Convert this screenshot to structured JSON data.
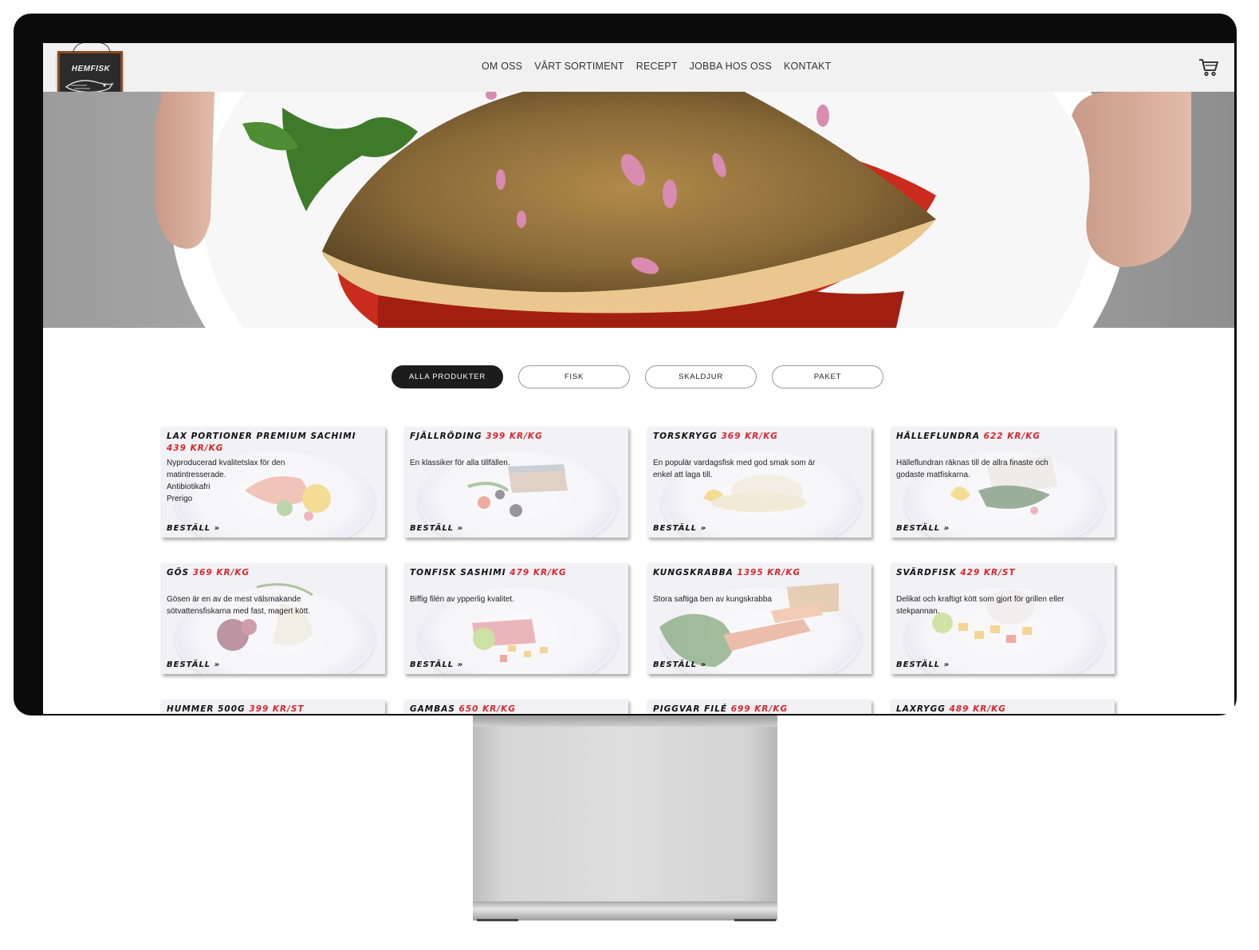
{
  "brand": {
    "logo_text": "www.HEMFISK.se"
  },
  "nav": {
    "items": [
      "OM OSS",
      "VÅRT SORTIMENT",
      "RECEPT",
      "JOBBA HOS OSS",
      "KONTAKT"
    ]
  },
  "filters": {
    "all": "ALLA PRODUKTER",
    "fish": "FISK",
    "shellfish": "SKALDJUR",
    "package": "PAKET"
  },
  "products": [
    {
      "name": "Lax portioner premium sachimi",
      "price": "439 kr/kg",
      "desc": "Nyproducerad kvalitetslax för den matintresserade.",
      "extra1": "Antibiotikafri",
      "extra2": "Prerigo",
      "order": "Beställ »"
    },
    {
      "name": "Fjällröding",
      "price": "399 kr/kg",
      "desc": "En klassiker för alla tillfällen.",
      "order": "Beställ »"
    },
    {
      "name": "Torskrygg",
      "price": "369 kr/kg",
      "desc": "En populär vardagsfisk med god smak som är enkel att laga till.",
      "order": "Beställ »"
    },
    {
      "name": "Hälleflundra",
      "price": "622 kr/kg",
      "desc": "Hälleflundran räknas till de allra finaste och godaste matfiskarna.",
      "order": "Beställ »"
    },
    {
      "name": "Gös",
      "price": "369 kr/kg",
      "desc": "Gösen är en av de mest välsmakande sötvattensfiskarna med fast, magert kött.",
      "order": "Beställ »"
    },
    {
      "name": "Tonfisk sashimi",
      "price": "479 kr/kg",
      "desc": "Biffig  filén av ypperlig kvalitet.",
      "order": "Beställ »"
    },
    {
      "name": "Kungskrabba",
      "price": "1395 kr/kg",
      "desc": "Stora saftiga ben av kungskrabba",
      "order": "Beställ »"
    },
    {
      "name": "Svärdfisk",
      "price": "429 kr/st",
      "desc": "Delikat och kraftigt kött som gjort för grillen eller stekpannan.",
      "order": "Beställ »"
    },
    {
      "name": "Hummer 500g",
      "price": "399 kr/st"
    },
    {
      "name": "Gambas",
      "price": "650 kr/kg"
    },
    {
      "name": "Piggvar filé",
      "price": "699 kr/kg"
    },
    {
      "name": "Laxrygg",
      "price": "489 kr/kg"
    }
  ],
  "colors": {
    "price": "#d7262b",
    "active_filter": "#1c1c1c",
    "nav_bg": "#f1f1f1",
    "bezel": "#0b0b0b"
  },
  "icons": {
    "cart": "cart-icon",
    "logo": "fish-logo-icon"
  }
}
